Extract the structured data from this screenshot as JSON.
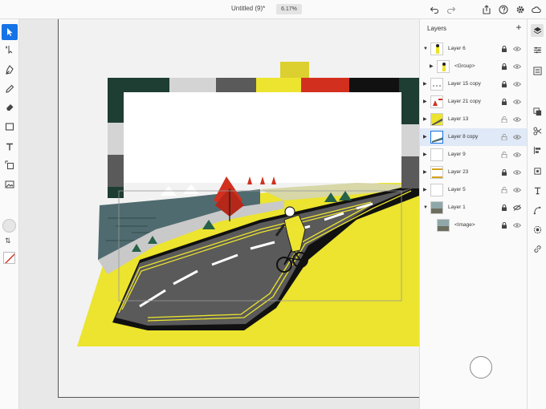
{
  "document": {
    "title": "Untitled (9)*",
    "zoom": "6.17%"
  },
  "topbar_icons": [
    "undo-icon",
    "redo-icon",
    "share-icon",
    "help-icon",
    "settings-icon",
    "cloud-icon"
  ],
  "tools": [
    "select-tool-icon",
    "direct-select-tool-icon",
    "pen-tool-icon",
    "pencil-tool-icon",
    "eraser-tool-icon",
    "shape-tool-icon",
    "text-tool-icon",
    "transform-tool-icon",
    "image-tool-icon"
  ],
  "swap_label": "⇅",
  "layers_panel": {
    "title": "Layers",
    "add_label": "+",
    "rows": [
      {
        "name": "Layer 6",
        "expanded": true,
        "locked": true,
        "visible": true,
        "selected": false
      },
      {
        "name": "<Group>",
        "expanded": false,
        "locked": true,
        "visible": true,
        "selected": false
      },
      {
        "name": "Layer 15 copy",
        "expanded": false,
        "locked": true,
        "visible": true,
        "selected": false
      },
      {
        "name": "Layer 21 copy",
        "expanded": false,
        "locked": true,
        "visible": true,
        "selected": false
      },
      {
        "name": "Layer 13",
        "expanded": false,
        "locked": false,
        "visible": true,
        "selected": false
      },
      {
        "name": "Layer 8 copy",
        "expanded": false,
        "locked": false,
        "visible": true,
        "selected": true
      },
      {
        "name": "Layer 9",
        "expanded": false,
        "locked": false,
        "visible": true,
        "selected": false
      },
      {
        "name": "Layer 23",
        "expanded": false,
        "locked": true,
        "visible": true,
        "selected": false
      },
      {
        "name": "Layer 5",
        "expanded": false,
        "locked": false,
        "visible": true,
        "selected": false
      },
      {
        "name": "Layer 1",
        "expanded": true,
        "locked": true,
        "visible": false,
        "selected": false
      },
      {
        "name": "<Image>",
        "expanded": false,
        "locked": true,
        "visible": true,
        "selected": false
      }
    ]
  },
  "right_icons": [
    "layers-icon",
    "properties-icon",
    "libraries-icon",
    "pathfinder-icon",
    "cut-icon",
    "align-icon",
    "transform-icon",
    "text-icon",
    "pen-curve-icon",
    "appearance-icon",
    "link-icon"
  ],
  "colors": {
    "accent": "#1473e6",
    "road": "#5a5a5a",
    "yellow": "#ece42e",
    "dark_green": "#1e3d33",
    "red": "#d22f1f"
  }
}
